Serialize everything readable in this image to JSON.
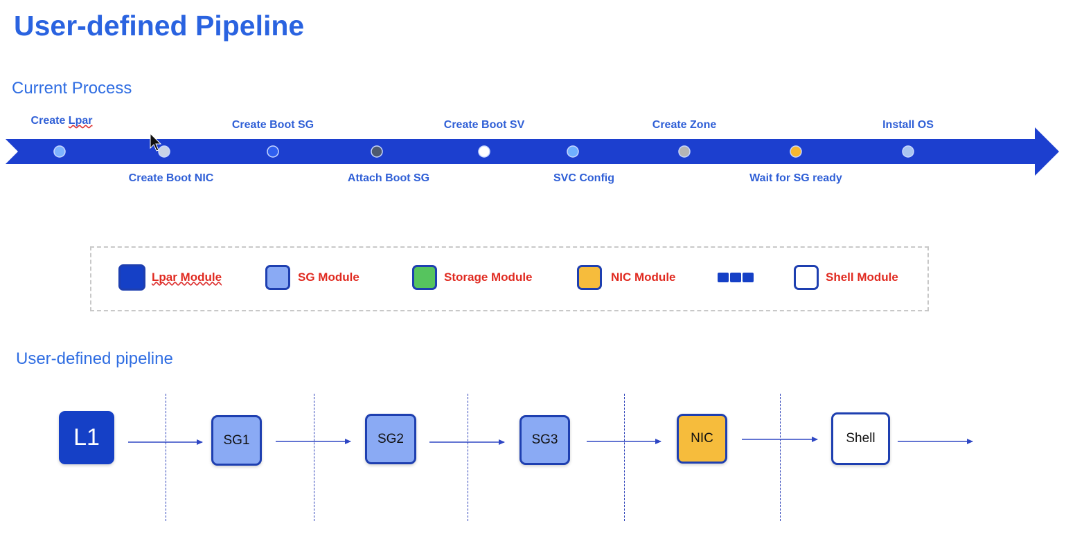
{
  "page_title": "User-defined Pipeline",
  "current_process": {
    "heading": "Current Process",
    "steps": [
      {
        "label": "Create Lpar",
        "position": "above",
        "dot_color": "#7db3ff"
      },
      {
        "label": "Create Boot NIC",
        "position": "below",
        "dot_color": "#c8d3e6"
      },
      {
        "label": "Create Boot SG",
        "position": "above",
        "dot_color": "#2f5ff0"
      },
      {
        "label": "Attach Boot SG",
        "position": "below",
        "dot_color": "#4d5a70"
      },
      {
        "label": "Create Boot SV",
        "position": "above",
        "dot_color": "#ffffff"
      },
      {
        "label": "SVC Config",
        "position": "below",
        "dot_color": "#6fb0ff"
      },
      {
        "label": "Create Zone",
        "position": "above",
        "dot_color": "#b5b5b5"
      },
      {
        "label": "Wait for SG ready",
        "position": "below",
        "dot_color": "#f5b731"
      },
      {
        "label": "Install OS",
        "position": "above",
        "dot_color": "#a9c5f0"
      }
    ],
    "arrow_color": "#1c3fcf"
  },
  "legend": {
    "items": [
      {
        "label": "Lpar Module",
        "swatch_color": "#1540c6",
        "icon": "lpar-module-swatch"
      },
      {
        "label": "SG Module",
        "swatch_color": "#8aaaf4",
        "icon": "sg-module-swatch"
      },
      {
        "label": "Storage Module",
        "swatch_color": "#56c45e",
        "icon": "storage-module-swatch"
      },
      {
        "label": "NIC Module",
        "swatch_color": "#f6bc3c",
        "icon": "nic-module-swatch"
      },
      {
        "label": "",
        "swatch_color": "#1540c6",
        "icon": "ellipsis-blocks-icon"
      },
      {
        "label": "Shell Module",
        "swatch_color": "#ffffff",
        "icon": "shell-module-swatch"
      }
    ]
  },
  "user_pipeline": {
    "heading": "User-defined pipeline",
    "nodes": [
      {
        "label": "L1",
        "type": "lpar",
        "fill": "#1540c6",
        "text_color": "#ffffff"
      },
      {
        "label": "SG1",
        "type": "sg",
        "fill": "#8aaaf4",
        "text_color": "#111111"
      },
      {
        "label": "SG2",
        "type": "sg",
        "fill": "#8aaaf4",
        "text_color": "#111111"
      },
      {
        "label": "SG3",
        "type": "sg",
        "fill": "#8aaaf4",
        "text_color": "#111111"
      },
      {
        "label": "NIC",
        "type": "nic",
        "fill": "#f6bc3c",
        "text_color": "#111111"
      },
      {
        "label": "Shell",
        "type": "shell",
        "fill": "#ffffff",
        "text_color": "#111111"
      }
    ],
    "connector_color": "#2f47c4"
  }
}
